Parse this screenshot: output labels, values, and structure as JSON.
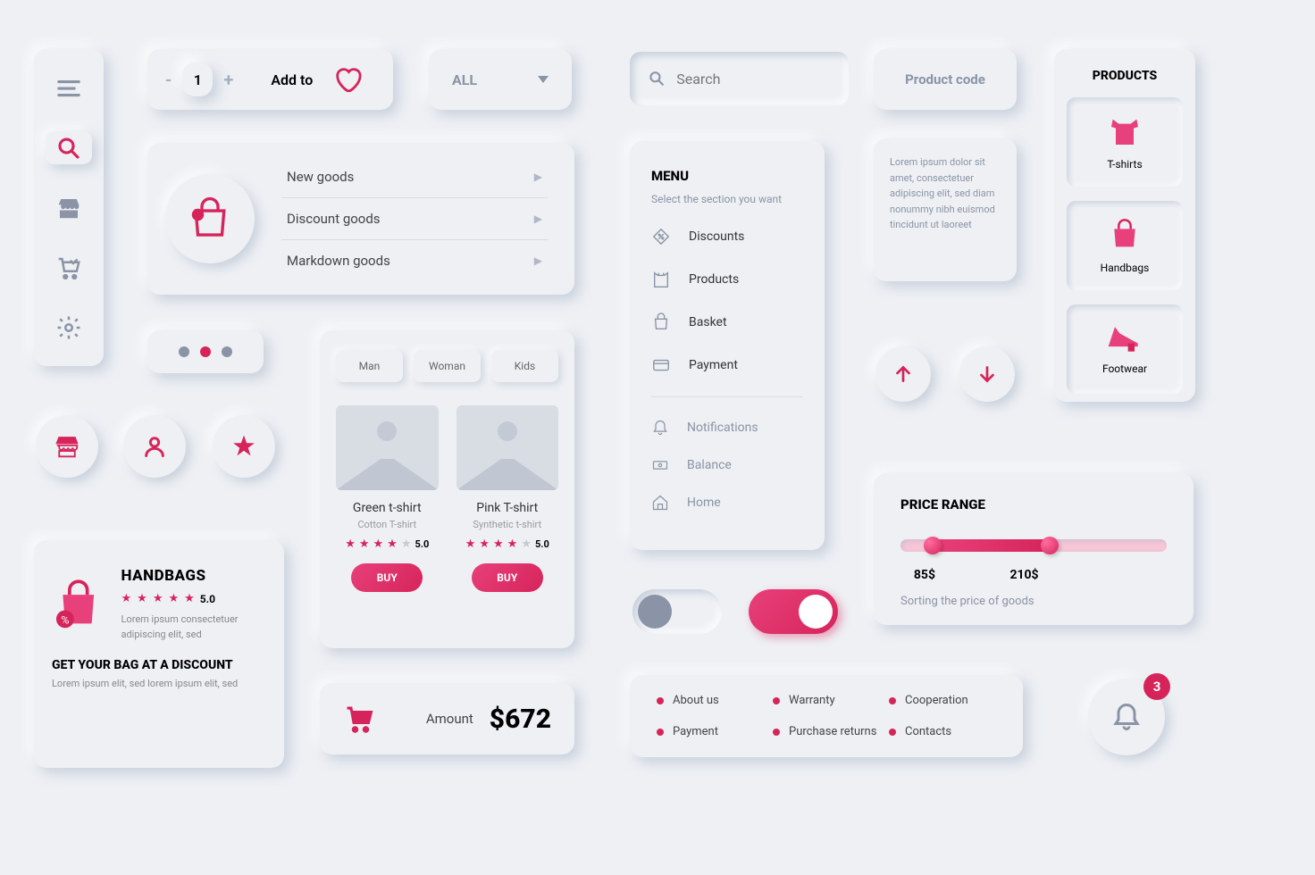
{
  "sidebar": {
    "items": [
      "menu",
      "search",
      "store",
      "cart",
      "settings"
    ]
  },
  "qty": {
    "value": "1",
    "label": "Add to"
  },
  "dropdown": {
    "value": "ALL"
  },
  "search": {
    "placeholder": "Search"
  },
  "productCode": {
    "label": "Product code"
  },
  "goods": {
    "items": [
      "New goods",
      "Discount goods",
      "Markdown goods"
    ]
  },
  "handbag": {
    "title": "HANDBAGS",
    "rating": "5.0",
    "lorem": "Lorem ipsum consectetuer adipiscing elit, sed",
    "cta": "GET YOUR BAG AT A DISCOUNT",
    "sub": "Lorem ipsum elit, sed lorem ipsum elit, sed"
  },
  "tabs": [
    "Man",
    "Woman",
    "Kids"
  ],
  "products": [
    {
      "name": "Green t-shirt",
      "sub": "Cotton T-shirt",
      "rating": "5.0",
      "buy": "BUY"
    },
    {
      "name": "Pink T-shirt",
      "sub": "Synthetic t-shirt",
      "rating": "5.0",
      "buy": "BUY"
    }
  ],
  "menu": {
    "title": "MENU",
    "sub": "Select the section you want",
    "primary": [
      "Discounts",
      "Products",
      "Basket",
      "Payment"
    ],
    "secondary": [
      "Notifications",
      "Balance",
      "Home"
    ]
  },
  "info": {
    "text": "Lorem ipsum dolor sit amet, consectetuer adipiscing elit, sed diam nonummy nibh euismod tincidunt ut laoreet"
  },
  "productsCol": {
    "title": "PRODUCTS",
    "items": [
      "T-shirts",
      "Handbags",
      "Footwear"
    ]
  },
  "price": {
    "title": "PRICE RANGE",
    "low": "85$",
    "high": "210$",
    "sub": "Sorting the price of goods"
  },
  "footerLinks": [
    "About us",
    "Warranty",
    "Cooperation",
    "Payment",
    "Purchase returns",
    "Contacts"
  ],
  "amount": {
    "label": "Amount",
    "value": "$672"
  },
  "bell": {
    "count": "3"
  }
}
